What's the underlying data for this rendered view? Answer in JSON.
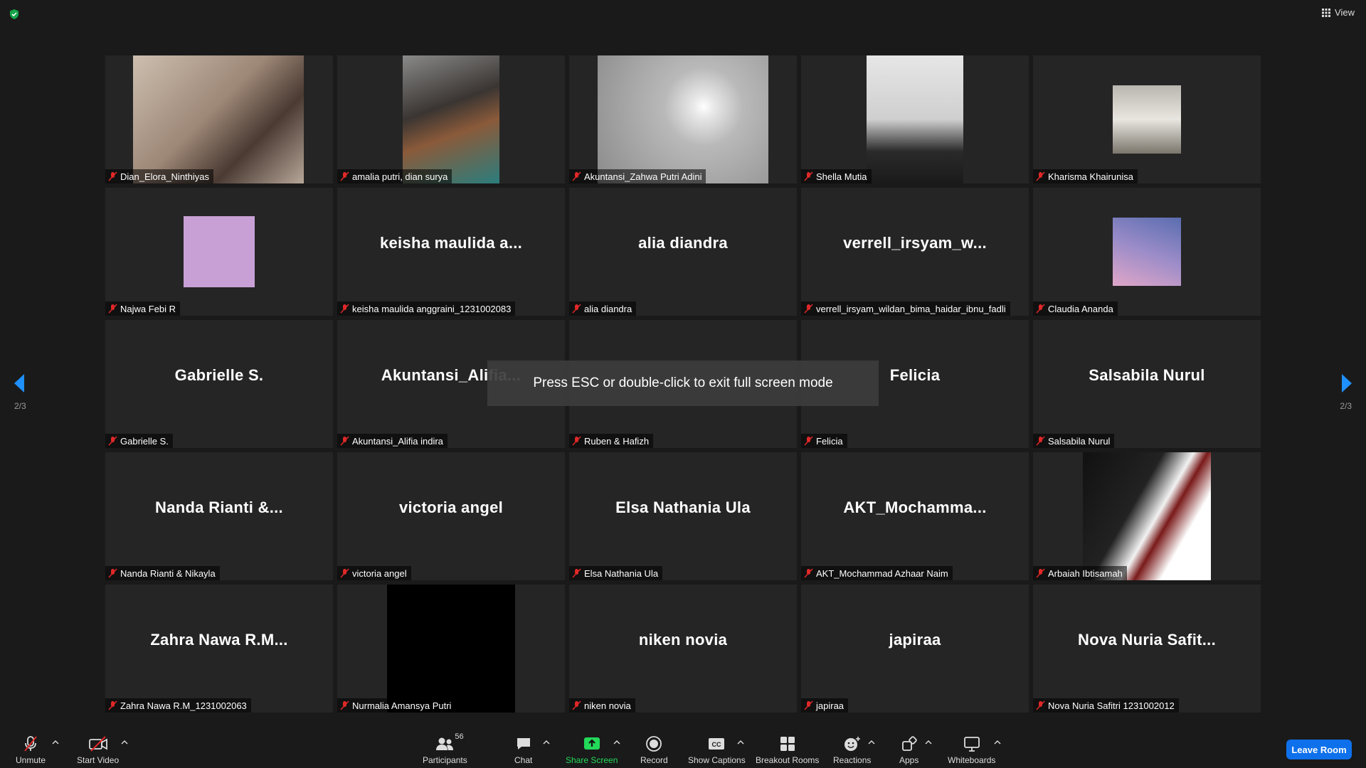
{
  "app": {
    "view_label": "View"
  },
  "pagination": {
    "left": "2/3",
    "right": "2/3"
  },
  "toast": "Press ESC or double-click to exit full screen mode",
  "tiles": [
    {
      "label": "Dian_Elora_Ninthiyas"
    },
    {
      "label": "amalia putri, dian surya"
    },
    {
      "label": "Akuntansi_Zahwa Putri Adini"
    },
    {
      "label": "Shella Mutia"
    },
    {
      "label": "Kharisma Khairunisa"
    },
    {
      "label": "Najwa Febi R"
    },
    {
      "label": "keisha maulida anggraini_1231002083",
      "display": "keisha maulida a..."
    },
    {
      "label": "alia diandra",
      "display": "alia diandra"
    },
    {
      "label": "verrell_irsyam_wildan_bima_haidar_ibnu_fadli",
      "display": "verrell_irsyam_w..."
    },
    {
      "label": "Claudia Ananda"
    },
    {
      "label": "Gabrielle S.",
      "display": "Gabrielle S."
    },
    {
      "label": "Akuntansi_Alifia indira",
      "display": "Akuntansi_Alifia..."
    },
    {
      "label": "Ruben & Hafizh",
      "display": ""
    },
    {
      "label": "Felicia",
      "display": "Felicia"
    },
    {
      "label": "Salsabila Nurul",
      "display": "Salsabila Nurul"
    },
    {
      "label": "Nanda Rianti & Nikayla",
      "display": "Nanda Rianti &..."
    },
    {
      "label": "victoria angel",
      "display": "victoria angel"
    },
    {
      "label": "Elsa Nathania Ula",
      "display": "Elsa Nathania Ula"
    },
    {
      "label": "AKT_Mochammad Azhaar Naim",
      "display": "AKT_Mochamma..."
    },
    {
      "label": "Arbaiah Ibtisamah"
    },
    {
      "label": "Zahra Nawa R.M_1231002063",
      "display": "Zahra Nawa R.M..."
    },
    {
      "label": "Nurmalia Amansya Putri"
    },
    {
      "label": "niken novia",
      "display": "niken novia"
    },
    {
      "label": "japiraa",
      "display": "japiraa"
    },
    {
      "label": "Nova Nuria Safitri 1231002012",
      "display": "Nova Nuria Safit..."
    }
  ],
  "toolbar": {
    "unmute": "Unmute",
    "start_video": "Start Video",
    "participants": "Participants",
    "participants_count": "56",
    "chat": "Chat",
    "share_screen": "Share Screen",
    "record": "Record",
    "show_captions": "Show Captions",
    "breakout_rooms": "Breakout Rooms",
    "reactions": "Reactions",
    "apps": "Apps",
    "whiteboards": "Whiteboards",
    "leave_room": "Leave Room"
  },
  "colors": {
    "accent_blue": "#0e71eb",
    "share_green": "#23d959",
    "muted_red": "#e02828",
    "shield_green": "#16a34a"
  }
}
